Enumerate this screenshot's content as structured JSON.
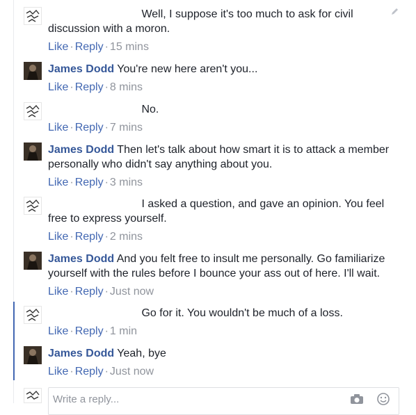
{
  "comments": [
    {
      "author": "",
      "text": "Well, I suppose it's too much to ask for civil discussion with a moron.",
      "like": "Like",
      "reply": "Reply",
      "time": "15 mins"
    },
    {
      "author": "James Dodd",
      "text": "You're new here aren't you...",
      "like": "Like",
      "reply": "Reply",
      "time": "8 mins"
    },
    {
      "author": "",
      "text": "No.",
      "like": "Like",
      "reply": "Reply",
      "time": "7 mins"
    },
    {
      "author": "James Dodd",
      "text": "Then let's talk about how smart it is to attack a member personally who didn't say anything about you.",
      "like": "Like",
      "reply": "Reply",
      "time": "3 mins"
    },
    {
      "author": "",
      "text": "I asked a question, and gave an opinion. You feel free to express yourself.",
      "like": "Like",
      "reply": "Reply",
      "time": "2 mins"
    },
    {
      "author": "James Dodd",
      "text": "And you felt free to insult me personally. Go familiarize yourself with the rules before I bounce your ass out of here. I'll wait.",
      "like": "Like",
      "reply": "Reply",
      "time": "Just now"
    },
    {
      "author": "",
      "text": "Go for it. You wouldn't be much of a loss.",
      "like": "Like",
      "reply": "Reply",
      "time": "1 min"
    },
    {
      "author": "James Dodd",
      "text": "Yeah, bye",
      "like": "Like",
      "reply": "Reply",
      "time": "Just now"
    }
  ],
  "reply_box": {
    "placeholder": "Write a reply..."
  },
  "colors": {
    "link": "#4267b2",
    "author": "#365899",
    "meta": "#90949c",
    "thread_highlight": "#4267b2"
  }
}
